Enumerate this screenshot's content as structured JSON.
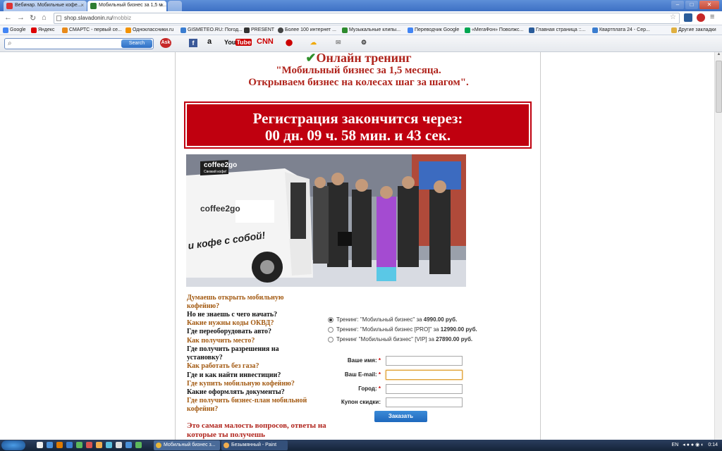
{
  "browser": {
    "tabs": [
      {
        "label": "Вебинар. Мобильные кофе...",
        "close": "×"
      },
      {
        "label": "Мобильный бизнес за 1,5 м...",
        "close": "×"
      }
    ],
    "url_host": "shop.slavadonin.ru/",
    "url_path": "mobbiz",
    "bookmarks": [
      "Google",
      "Яндекс",
      "СМАРТС - первый се...",
      "Одноклассники.ru",
      "GISMETEO.RU: Погод...",
      "PRESENT",
      "Более 100 интернет ...",
      "Музыкальные клипы...",
      "Переводчик Google",
      "«МегаФон» Поволжс...",
      "Главная страница ::...",
      "Квартплата 24 - Сер..."
    ],
    "other_bookmarks": "Другие закладки",
    "ask_search_button": "Search"
  },
  "page": {
    "title": "Онлайн тренинг",
    "subtitle1": "\"Мобильный бизнес за 1,5 месяца.",
    "subtitle2": "Открываем бизнес на колесах шаг за шагом\".",
    "timer_line1": "Регистрация закончится через:",
    "timer_line2": "00 дн. 09 ч. 58 мин. и 43 сек.",
    "photo_brand": "coffee2go",
    "photo_tagline": "Свежий кофе!",
    "van_text": "и кофе с собой!",
    "questions": [
      {
        "text": "Думаешь открыть мобильную кофейню?",
        "style": "o"
      },
      {
        "text": "Но не знаешь с чего начать?",
        "style": "b"
      },
      {
        "text": "Какие нужны коды ОКВД?",
        "style": "o"
      },
      {
        "text": "Где переоборудовать авто?",
        "style": "b"
      },
      {
        "text": "Как получить место?",
        "style": "o"
      },
      {
        "text": "Где получить разрешения на установку?",
        "style": "b"
      },
      {
        "text": "Как работать без газа?",
        "style": "o"
      },
      {
        "text": "Где и как найти инвестиции?",
        "style": "b"
      },
      {
        "text": "Где купить мобильную кофейню?",
        "style": "o"
      },
      {
        "text": "Какие оформлять документы?",
        "style": "b"
      },
      {
        "text": "Где получить бизнес-план мобильной кофейни?",
        "style": "o"
      }
    ],
    "bottom_text": "Это самая малость вопросов, ответы на которые ты получешь",
    "options": [
      {
        "label": "Тренинг: \"Мобильный бизнес\" за ",
        "price": "4990.00 руб.",
        "selected": true
      },
      {
        "label": "Тренинг: \"Мобильный бизнес [PRO]\" за ",
        "price": "12990.00 руб.",
        "selected": false
      },
      {
        "label": "Тренинг \"Мобильный бизнес\" [VIP] за ",
        "price": "27890.00 руб.",
        "selected": false
      }
    ],
    "form": {
      "name_label": "Ваше имя:",
      "email_label": "Ваш E-mail:",
      "city_label": "Город:",
      "coupon_label": "Купон скидки:",
      "required_mark": "*",
      "submit": "Заказать"
    }
  },
  "taskbar": {
    "tasks": [
      "Мобильный бизнес з...",
      "Безымянный - Paint"
    ],
    "lang": "EN",
    "time": "0:14"
  }
}
